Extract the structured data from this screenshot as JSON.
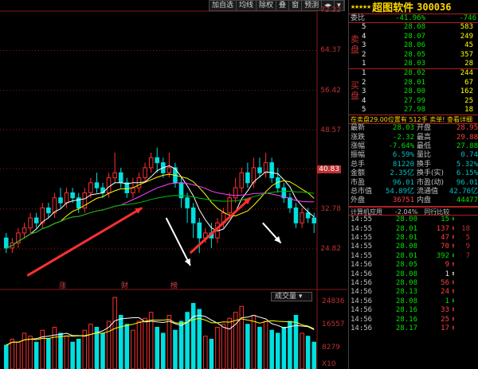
{
  "toolbar": {
    "items": [
      "加自选",
      "均线",
      "除权",
      "叠",
      "窗",
      "预测",
      "◂▸",
      "▾"
    ]
  },
  "price_labels": [
    "72.22",
    "64.37",
    "56.42",
    "48.57",
    "40.83",
    "32.78",
    "24.82"
  ],
  "current_price_marker": "40.83",
  "vol_labels": [
    "24836",
    "16557",
    "8279",
    "X10"
  ],
  "volume_button": "成交量 ▾",
  "markers": [
    "涨",
    "财",
    "榜"
  ],
  "chart_colors": {
    "up": "#ff3030",
    "down": "#00e0e0",
    "ma5": "#ffffff",
    "ma10": "#ffff00",
    "ma20": "#ff40ff",
    "ma60": "#00c000",
    "arrow_red": "#ff3030",
    "arrow_white": "#ffffff"
  },
  "chart_data": {
    "type": "candlestick",
    "ylim": [
      18,
      72.22
    ],
    "candles": [
      [
        27,
        25,
        28,
        24
      ],
      [
        25,
        26,
        27,
        24
      ],
      [
        26,
        28,
        29,
        25
      ],
      [
        28,
        29,
        30,
        27
      ],
      [
        29,
        31,
        32,
        28
      ],
      [
        31,
        30,
        32,
        29
      ],
      [
        30,
        33,
        34,
        29
      ],
      [
        33,
        32,
        34,
        31
      ],
      [
        32,
        35,
        36,
        31
      ],
      [
        35,
        34,
        37,
        33
      ],
      [
        34,
        36,
        37,
        33
      ],
      [
        36,
        35,
        37,
        34
      ],
      [
        35,
        33,
        36,
        32
      ],
      [
        33,
        36,
        37,
        32
      ],
      [
        36,
        38,
        39,
        35
      ],
      [
        38,
        37,
        40,
        36
      ],
      [
        37,
        36,
        38,
        35
      ],
      [
        36,
        39,
        40,
        35
      ],
      [
        39,
        40,
        44,
        38
      ],
      [
        40,
        38,
        41,
        37
      ],
      [
        38,
        36,
        39,
        35
      ],
      [
        36,
        37,
        39,
        35
      ],
      [
        37,
        39,
        40,
        36
      ],
      [
        39,
        41,
        42,
        38
      ],
      [
        41,
        43,
        44,
        40
      ],
      [
        43,
        42,
        45,
        40
      ],
      [
        42,
        40,
        43,
        39
      ],
      [
        40,
        41,
        44,
        39
      ],
      [
        41,
        38,
        42,
        37
      ],
      [
        38,
        35,
        39,
        33
      ],
      [
        35,
        33,
        36,
        30
      ],
      [
        33,
        30,
        34,
        27
      ],
      [
        30,
        27,
        31,
        24
      ],
      [
        27,
        28,
        29,
        26
      ],
      [
        28,
        27,
        30,
        25
      ],
      [
        27,
        30,
        31,
        26
      ],
      [
        30,
        32,
        33,
        29
      ],
      [
        32,
        35,
        36,
        31
      ],
      [
        35,
        37,
        39,
        34
      ],
      [
        37,
        40,
        41,
        36
      ],
      [
        40,
        38,
        42,
        37
      ],
      [
        38,
        41,
        43,
        37
      ],
      [
        41,
        40,
        43,
        39
      ],
      [
        40,
        42,
        44,
        39
      ],
      [
        42,
        39,
        43,
        38
      ],
      [
        39,
        37,
        41,
        36
      ],
      [
        37,
        35,
        38,
        34
      ],
      [
        35,
        33,
        36,
        32
      ],
      [
        33,
        30,
        34,
        29
      ],
      [
        30,
        32,
        33,
        29
      ],
      [
        32,
        31,
        33,
        30
      ],
      [
        31,
        30,
        32,
        28
      ]
    ],
    "volumes": [
      8,
      10,
      9,
      12,
      11,
      9,
      13,
      10,
      14,
      12,
      11,
      9,
      10,
      13,
      15,
      14,
      12,
      16,
      24,
      18,
      15,
      13,
      16,
      17,
      19,
      14,
      12,
      18,
      13,
      16,
      19,
      22,
      20,
      11,
      10,
      14,
      15,
      17,
      19,
      21,
      15,
      18,
      14,
      16,
      13,
      12,
      14,
      16,
      18,
      12,
      11,
      9
    ],
    "vol_max": 24836
  },
  "quote": {
    "stars": "★★★★★",
    "name": "超图软件",
    "code": "300036",
    "weibi_label": "委比",
    "weibi_pct": "-41.96%",
    "weibi_val": "-746",
    "sell_label": "卖盘",
    "buy_label": "买盘",
    "sells": [
      {
        "n": "5",
        "p": "28.08",
        "v": "583"
      },
      {
        "n": "4",
        "p": "28.07",
        "v": "249"
      },
      {
        "n": "3",
        "p": "28.06",
        "v": "45"
      },
      {
        "n": "2",
        "p": "28.05",
        "v": "357"
      },
      {
        "n": "1",
        "p": "28.03",
        "v": "28"
      }
    ],
    "buys": [
      {
        "n": "1",
        "p": "28.02",
        "v": "244"
      },
      {
        "n": "2",
        "p": "28.01",
        "v": "67"
      },
      {
        "n": "3",
        "p": "28.00",
        "v": "162"
      },
      {
        "n": "4",
        "p": "27.99",
        "v": "25"
      },
      {
        "n": "5",
        "p": "27.98",
        "v": "18"
      }
    ],
    "info_line": "在卖盘29.00位置有 512手 卖单! 查看详细",
    "stats": [
      {
        "k": "最新",
        "v": "28.03",
        "vc": "green",
        "k2": "开盘",
        "v2": "28.95",
        "v2c": "red"
      },
      {
        "k": "涨跌",
        "v": "-2.32",
        "vc": "green",
        "k2": "最高",
        "v2": "29.88",
        "v2c": "red"
      },
      {
        "k": "涨幅",
        "v": "-7.64%",
        "vc": "green",
        "k2": "最低",
        "v2": "27.88",
        "v2c": "green"
      },
      {
        "k": "振幅",
        "v": "6.59%",
        "vc": "cyan",
        "k2": "量比",
        "v2": "0.74",
        "v2c": "cyan"
      },
      {
        "k": "总手",
        "v": "81220",
        "vc": "cyan",
        "k2": "换手",
        "v2": "5.32%",
        "v2c": "cyan"
      },
      {
        "k": "金额",
        "v": "2.35亿",
        "vc": "cyan",
        "k2": "换手(实)",
        "v2": "6.15%",
        "v2c": "cyan"
      },
      {
        "k": "市盈",
        "v": "96.01",
        "vc": "cyan",
        "k2": "市盈(动)",
        "v2": "96.01",
        "v2c": "cyan"
      },
      {
        "k": "总市值",
        "v": "54.89亿",
        "vc": "cyan",
        "k2": "流通值",
        "v2": "42.76亿",
        "v2c": "cyan"
      },
      {
        "k": "外盘",
        "v": "36751",
        "vc": "red",
        "k2": "内盘",
        "v2": "44477",
        "v2c": "green"
      }
    ],
    "ticks_header": "计算机应用　　-2.04%　同行比较",
    "ticks": [
      {
        "t": "14:55",
        "p": "28.00",
        "v": "15",
        "a": "down",
        "c": ""
      },
      {
        "t": "14:55",
        "p": "28.01",
        "v": "137",
        "a": "up",
        "c": "18"
      },
      {
        "t": "14:55",
        "p": "28.01",
        "v": "47",
        "a": "up",
        "c": "5"
      },
      {
        "t": "14:55",
        "p": "28.08",
        "v": "70",
        "a": "up",
        "c": "9"
      },
      {
        "t": "14:55",
        "p": "28.01",
        "v": "392",
        "a": "down",
        "c": "7"
      },
      {
        "t": "14:56",
        "p": "28.05",
        "v": "9",
        "a": "up",
        "c": ""
      },
      {
        "t": "14:56",
        "p": "28.08",
        "v": "1",
        "a": "upw",
        "c": ""
      },
      {
        "t": "14:56",
        "p": "28.08",
        "v": "56",
        "a": "up",
        "c": ""
      },
      {
        "t": "14:56",
        "p": "28.13",
        "v": "24",
        "a": "up",
        "c": ""
      },
      {
        "t": "14:56",
        "p": "28.08",
        "v": "1",
        "a": "down",
        "c": ""
      },
      {
        "t": "14:56",
        "p": "28.16",
        "v": "33",
        "a": "up",
        "c": ""
      },
      {
        "t": "14:56",
        "p": "28.16",
        "v": "25",
        "a": "up",
        "c": ""
      },
      {
        "t": "14:56",
        "p": "28.17",
        "v": "17",
        "a": "up",
        "c": ""
      }
    ]
  }
}
